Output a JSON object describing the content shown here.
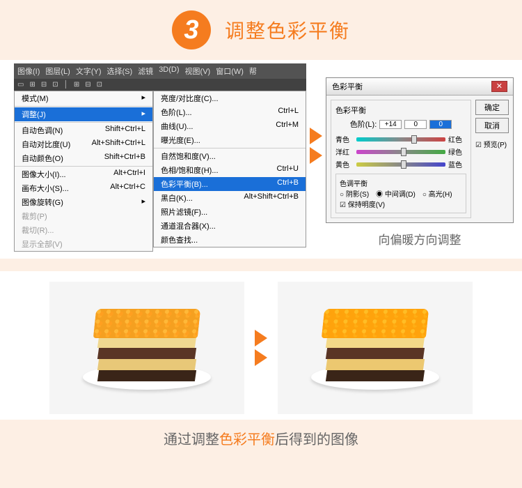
{
  "header": {
    "step": "3",
    "title": "调整色彩平衡"
  },
  "menubar": [
    "图像(I)",
    "图层(L)",
    "文字(Y)",
    "选择(S)",
    "滤镜",
    "3D(D)",
    "视图(V)",
    "窗口(W)",
    "帮"
  ],
  "menu_mode": "模式(M)",
  "menu_adjust": "调整(J)",
  "menu_left": [
    {
      "t": "自动色调(N)",
      "s": "Shift+Ctrl+L"
    },
    {
      "t": "自动对比度(U)",
      "s": "Alt+Shift+Ctrl+L"
    },
    {
      "t": "自动颜色(O)",
      "s": "Shift+Ctrl+B"
    },
    {
      "sep": true
    },
    {
      "t": "图像大小(I)...",
      "s": "Alt+Ctrl+I"
    },
    {
      "t": "画布大小(S)...",
      "s": "Alt+Ctrl+C"
    },
    {
      "t": "图像旋转(G)",
      "s": "▸"
    },
    {
      "t": "裁剪(P)",
      "dis": true
    },
    {
      "t": "裁切(R)...",
      "dis": true
    },
    {
      "t": "显示全部(V)",
      "dis": true
    }
  ],
  "menu_right": [
    {
      "t": "亮度/对比度(C)..."
    },
    {
      "t": "色阶(L)...",
      "s": "Ctrl+L"
    },
    {
      "t": "曲线(U)...",
      "s": "Ctrl+M"
    },
    {
      "t": "曝光度(E)..."
    },
    {
      "sep": true
    },
    {
      "t": "自然饱和度(V)..."
    },
    {
      "t": "色相/饱和度(H)...",
      "s": "Ctrl+U"
    },
    {
      "t": "色彩平衡(B)...",
      "s": "Ctrl+B",
      "sel": true
    },
    {
      "t": "黑白(K)...",
      "s": "Alt+Shift+Ctrl+B"
    },
    {
      "t": "照片滤镜(F)..."
    },
    {
      "t": "通道混合器(X)..."
    },
    {
      "t": "颜色查找..."
    }
  ],
  "dialog": {
    "title": "色彩平衡",
    "group": "色彩平衡",
    "levels_label": "色阶(L):",
    "v1": "+14",
    "v2": "0",
    "v3": "0",
    "rows": [
      {
        "l": "青色",
        "r": "红色",
        "pos": 62
      },
      {
        "l": "洋红",
        "r": "绿色",
        "pos": 50
      },
      {
        "l": "黄色",
        "r": "蓝色",
        "pos": 50
      }
    ],
    "tone_group": "色调平衡",
    "tone": [
      "阴影(S)",
      "中间调(D)",
      "高光(H)"
    ],
    "preserve": "保持明度(V)",
    "ok": "确定",
    "cancel": "取消",
    "preview": "预览(P)"
  },
  "caption1": "向偏暖方向调整",
  "caption2_a": "通过调整",
  "caption2_b": "色彩平衡",
  "caption2_c": "后得到的图像"
}
